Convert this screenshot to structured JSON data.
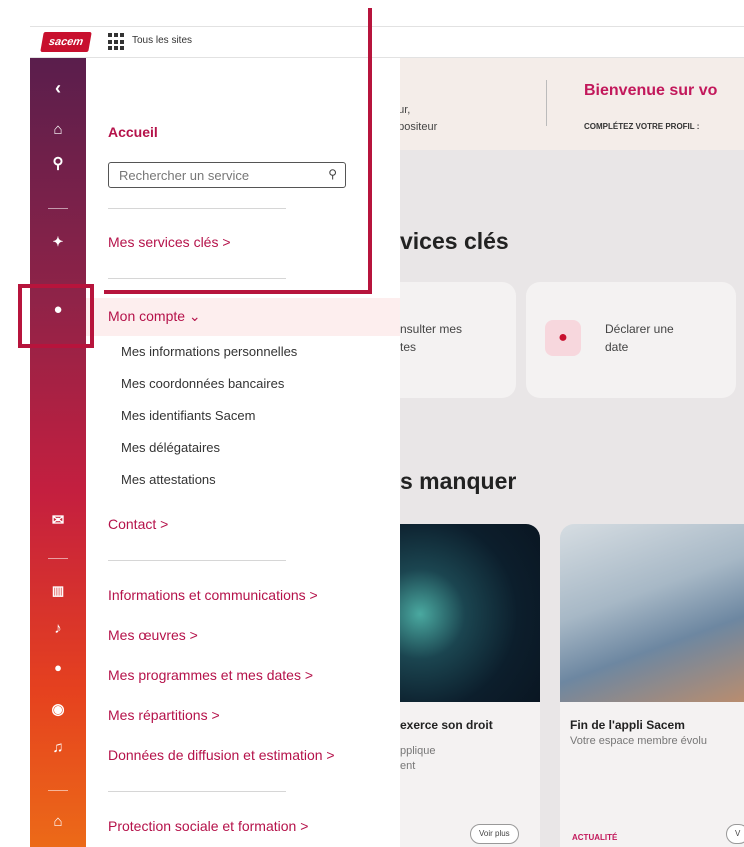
{
  "topbar": {
    "logo_text": "sacem",
    "all_sites_label": "Tous les sites"
  },
  "background": {
    "banner": {
      "name_fragment": "o",
      "line1_fragment": "eur,",
      "line2_fragment": "npositeur",
      "welcome": "Bienvenue sur vo",
      "complete_profile": "COMPLÉTEZ VOTRE PROFIL :"
    },
    "key_services_heading": "vices clés",
    "card1_line1": "nsulter mes",
    "card1_line2": "tes",
    "card2_line1": "Déclarer une",
    "card2_line2": "date",
    "dont_miss_heading": "s manquer",
    "news1": {
      "title": " exerce son droit",
      "sub1": "pplique",
      "sub2": "ent",
      "button": "Voir plus"
    },
    "news2": {
      "title": "Fin de l'appli Sacem",
      "sub": "Votre espace membre évolu",
      "tag": "ACTUALITÉ",
      "button_fragment": "V"
    }
  },
  "rail": {
    "icons": [
      "back-chevron-icon",
      "home-icon",
      "search-icon",
      "pin-icon",
      "user-icon",
      "mail-icon",
      "library-icon",
      "music-note-icon",
      "microphone-icon",
      "broadcast-icon",
      "music-icon",
      "shield-home-icon"
    ],
    "highlight_color": "#b7143c"
  },
  "menu": {
    "home": "Accueil",
    "search_placeholder": "Rechercher un service",
    "key_services": "Mes services clés >",
    "account": "Mon compte ⌄",
    "account_items": [
      "Mes informations personnelles",
      "Mes coordonnées bancaires",
      "Mes identifiants Sacem",
      "Mes délégataires",
      "Mes attestations"
    ],
    "contact": "Contact >",
    "info_comm": "Informations et communications >",
    "works": "Mes œuvres >",
    "programs": "Mes programmes et mes dates >",
    "distributions": "Mes répartitions >",
    "broadcast_data": "Données de diffusion et estimation >",
    "social": "Protection sociale et formation >"
  },
  "colors": {
    "accent": "#b5124a",
    "annotation": "#b7143c",
    "account_row_bg": "#fdeeee"
  }
}
